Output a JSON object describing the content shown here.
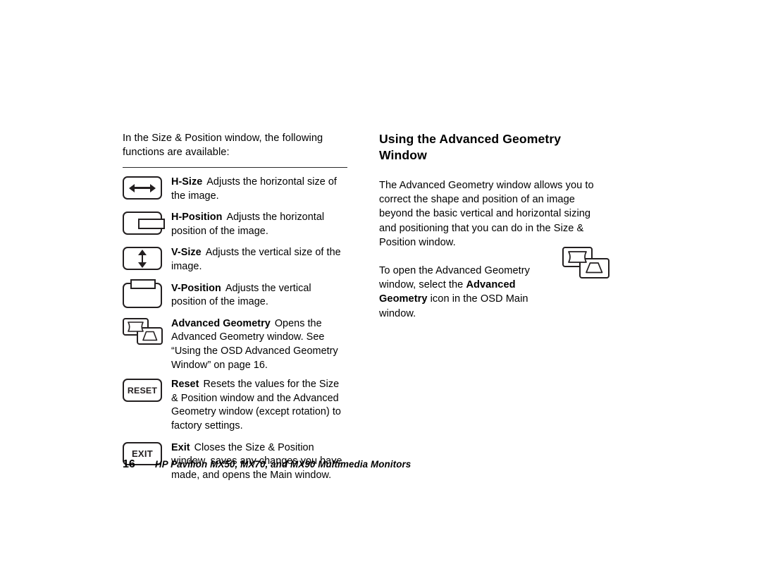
{
  "page": {
    "background_color": "#ffffff",
    "ink_color": "#231f20"
  },
  "left_column": {
    "intro_text": "In the Size & Position window, the following functions are available:",
    "items": [
      {
        "icon": "h-size-icon",
        "term": "H-Size",
        "description": "Adjusts the horizontal size of the image."
      },
      {
        "icon": "h-position-icon",
        "term": "H-Position",
        "description": "Adjusts the horizontal position of the image."
      },
      {
        "icon": "v-size-icon",
        "term": "V-Size",
        "description": "Adjusts  the vertical size of the image."
      },
      {
        "icon": "v-position-icon",
        "term": "V-Position",
        "description": "Adjusts the vertical position of the image."
      },
      {
        "icon": "advanced-geometry-icon",
        "term": "Advanced Geometry",
        "description": "Opens the Advanced Geometry window. See “Using the OSD Advanced Geometry Window” on page 16."
      },
      {
        "icon": "reset-button-icon",
        "icon_label": "RESET",
        "term": "Reset",
        "description": "Resets the values for the Size & Position window and the Advanced Geometry window (except rotation) to factory settings."
      },
      {
        "icon": "exit-button-icon",
        "icon_label": "EXIT",
        "term": "Exit",
        "description": "Closes the Size & Position window, saves any changes you have made, and opens the Main window."
      }
    ]
  },
  "right_column": {
    "heading": "Using the Advanced Geometry Window",
    "paragraph_1": "The Advanced Geometry window allows you to correct the shape and position of an image beyond the basic vertical and horizontal sizing and positioning that you can do in the Size & Position window.",
    "paragraph_2": {
      "part_1": "To open the Advanced Geometry window, select the ",
      "bold_1": "Advanced Geometry",
      "part_2": " icon in the OSD Main window."
    },
    "side_icon": "advanced-geometry-icon"
  },
  "footer": {
    "page_number": "16",
    "title": "HP Pavilion MX50, MX70, and MX90 Multimedia Monitors"
  }
}
